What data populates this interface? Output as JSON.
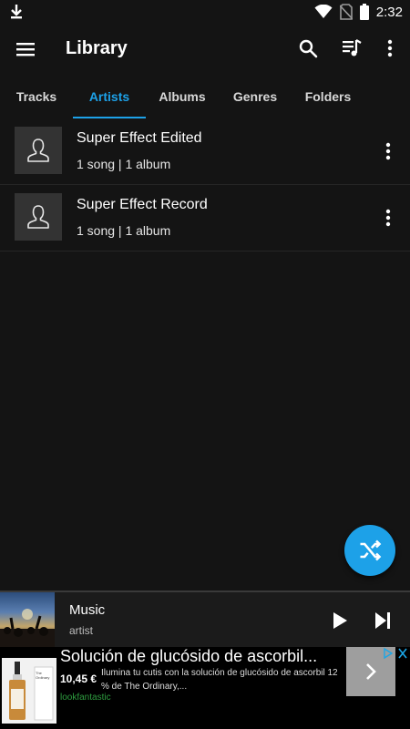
{
  "status_bar": {
    "time": "2:32",
    "icons": [
      "download-icon",
      "wifi-icon",
      "no-sim-icon",
      "battery-icon"
    ]
  },
  "toolbar": {
    "title": "Library",
    "icons": [
      "menu-icon",
      "search-icon",
      "queue-music-icon",
      "more-vert-icon"
    ]
  },
  "tabs": [
    {
      "label": "Tracks",
      "active": false
    },
    {
      "label": "Artists",
      "active": true
    },
    {
      "label": "Albums",
      "active": false
    },
    {
      "label": "Genres",
      "active": false
    },
    {
      "label": "Folders",
      "active": false
    }
  ],
  "artists": [
    {
      "name": "Super Effect Edited",
      "meta": "1 song | 1 album"
    },
    {
      "name": "Super Effect Record",
      "meta": "1 song | 1 album"
    }
  ],
  "fab": {
    "icon": "shuffle-icon"
  },
  "now_playing": {
    "track": "Music",
    "artist": "artist",
    "icons": [
      "play-icon",
      "skip-next-icon"
    ]
  },
  "ad": {
    "headline": "Solución de glucósido de ascorbil...",
    "price": "10,45 €",
    "description": "Ilumina tu cutis con la solución de glucósido de ascorbil 12 % de The Ordinary,...",
    "brand": "lookfantastic",
    "product_label": "The Ordinary"
  },
  "colors": {
    "background": "#141414",
    "accent": "#1da1e8",
    "thumb": "#333333",
    "ad_brand": "#2e9d3f"
  }
}
